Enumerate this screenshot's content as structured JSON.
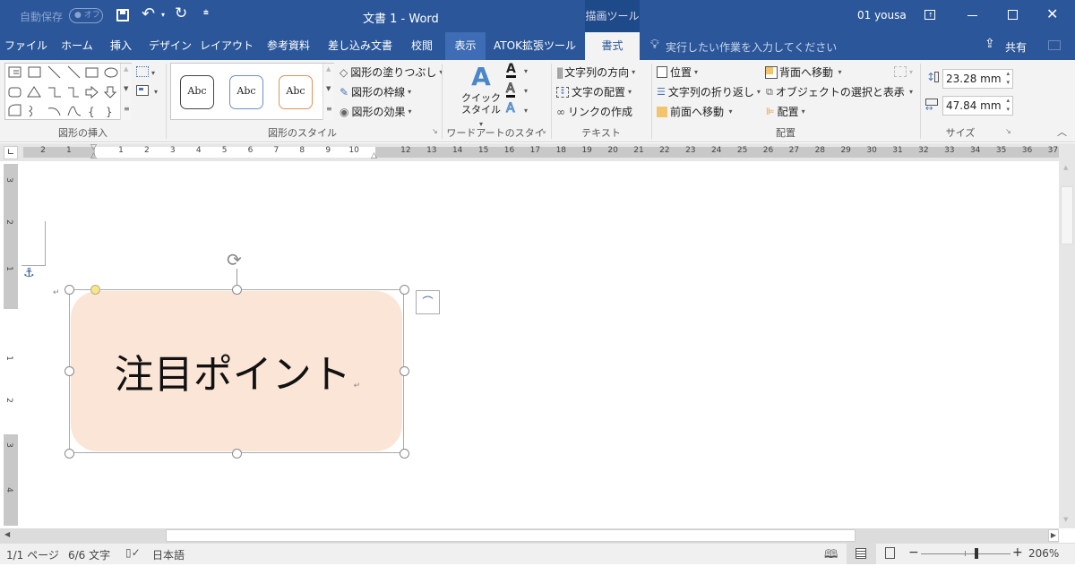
{
  "titlebar": {
    "autosave_label": "自動保存",
    "autosave_state": "オフ",
    "title": "文書 1  -  Word",
    "context_tool": "描画ツール",
    "user": "01 yousa",
    "icons": [
      "save-icon",
      "undo-icon",
      "redo-icon",
      "customize-qat-icon",
      "ribbon-display-icon",
      "minimize-icon",
      "maximize-icon",
      "close-icon"
    ]
  },
  "tabs": [
    {
      "label": "ファイル"
    },
    {
      "label": "ホーム"
    },
    {
      "label": "挿入"
    },
    {
      "label": "デザイン"
    },
    {
      "label": "レイアウト"
    },
    {
      "label": "参考資料"
    },
    {
      "label": "差し込み文書"
    },
    {
      "label": "校閲"
    },
    {
      "label": "表示"
    },
    {
      "label": "ATOK拡張ツール"
    },
    {
      "label": "書式"
    }
  ],
  "tellme": {
    "placeholder": "実行したい作業を入力してください"
  },
  "share": {
    "label": "共有"
  },
  "ribbon": {
    "insert_shapes": {
      "label": "図形の挿入"
    },
    "shape_styles": {
      "label": "図形のスタイル",
      "samples": [
        {
          "text": "Abc",
          "color": "#444444"
        },
        {
          "text": "Abc",
          "color": "#6d8fc7"
        },
        {
          "text": "Abc",
          "color": "#e0915a"
        }
      ],
      "fill": "図形の塗りつぶし",
      "outline": "図形の枠線",
      "effects": "図形の効果"
    },
    "wordart": {
      "label": "ワードアートのスタイル",
      "quick_style_line1": "クイック",
      "quick_style_line2": "スタイル"
    },
    "text": {
      "label": "テキスト",
      "direction": "文字列の方向",
      "align": "文字の配置",
      "link": "リンクの作成"
    },
    "arrange": {
      "label": "配置",
      "position": "位置",
      "wrap": "文字列の折り返し",
      "bring_forward": "前面へ移動",
      "send_backward": "背面へ移動",
      "selection_pane": "オブジェクトの選択と表示",
      "align": "配置"
    },
    "size": {
      "label": "サイズ",
      "height": "23.28 mm",
      "width": "47.84 mm"
    }
  },
  "ruler": {
    "left_numbers": [
      "2",
      "1"
    ],
    "numbers": [
      "1",
      "2",
      "3",
      "4",
      "5",
      "6",
      "7",
      "8",
      "9",
      "10",
      "",
      "12",
      "13",
      "14",
      "15",
      "16",
      "17",
      "18",
      "19",
      "20",
      "21",
      "22",
      "23",
      "24",
      "25",
      "26",
      "27",
      "28",
      "29",
      "30",
      "31",
      "32",
      "33",
      "34",
      "35",
      "36",
      "37"
    ],
    "vertical": [
      "3",
      "2",
      "1",
      "1",
      "2",
      "3",
      "4"
    ]
  },
  "document": {
    "shape_text": "注目ポイント",
    "shape_fill": "#fbe5d6"
  },
  "status": {
    "page": "1/1 ページ",
    "words": "6/6 文字",
    "language": "日本語",
    "zoom": "206%",
    "zoom_percent": 206
  }
}
